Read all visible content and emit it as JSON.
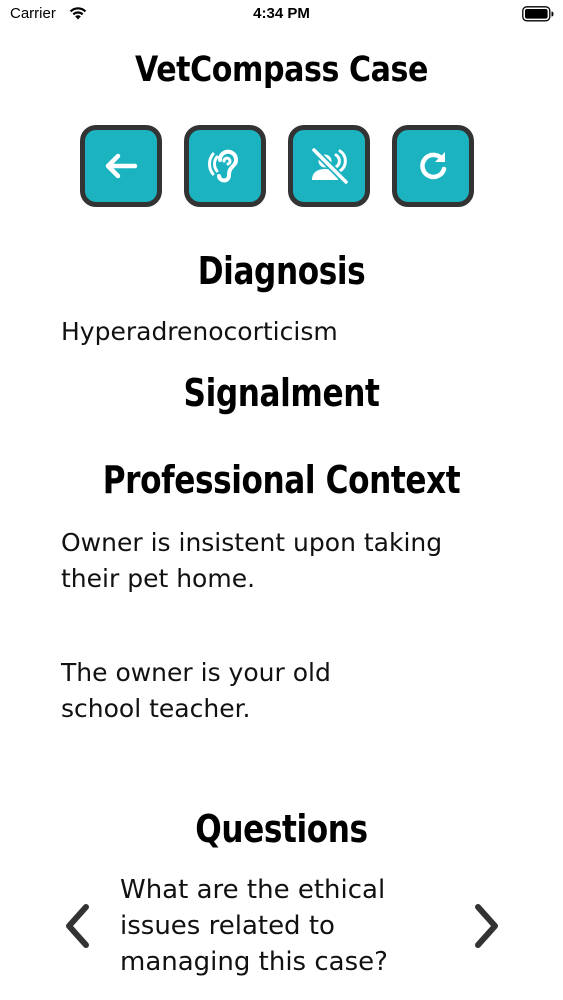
{
  "status_bar": {
    "carrier": "Carrier",
    "time": "4:34 PM"
  },
  "screen": {
    "title": "VetCompass Case"
  },
  "toolbar": {
    "accent_color": "#1bb3c0",
    "border_color": "#333333",
    "buttons": [
      {
        "icon": "arrow-left-icon"
      },
      {
        "icon": "hearing-icon"
      },
      {
        "icon": "voice-off-icon"
      },
      {
        "icon": "refresh-icon"
      }
    ]
  },
  "diagnosis": {
    "heading": "Diagnosis",
    "text": "Hyperadrenocorticism"
  },
  "signalment": {
    "heading": "Signalment"
  },
  "professional_context": {
    "heading": "Professional Context",
    "paragraphs": [
      "Owner is insistent upon taking their pet home.",
      "The owner is your old school teacher."
    ]
  },
  "questions": {
    "heading": "Questions",
    "current": "What are the ethical issues related to managing this case?"
  }
}
